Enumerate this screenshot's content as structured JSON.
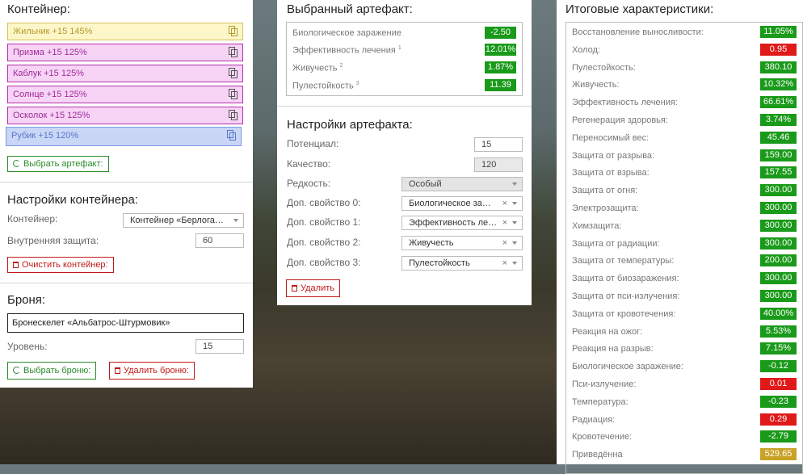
{
  "container_panel": {
    "title": "Контейнер:",
    "slots": [
      {
        "label": "Жильник +15 145%"
      },
      {
        "label": "Призма +15 125%"
      },
      {
        "label": "Каблук +15 125%"
      },
      {
        "label": "Солнце +15 125%"
      },
      {
        "label": "Осколок +15 125%"
      },
      {
        "label": "Рубик +15 120%"
      }
    ],
    "choose_artifact_button": "Выбрать артефакт:",
    "settings_title": "Настройки контейнера:",
    "container_label": "Контейнер:",
    "container_value": "Контейнер «Берлога…",
    "inner_protection_label": "Внутренняя защита:",
    "inner_protection_value": "60",
    "clear_button": "Очистить контейнер:",
    "armor_title": "Броня:",
    "armor_value": "Бронескелет «Альбатрос-Штурмовик»",
    "level_label": "Уровень:",
    "level_value": "15",
    "choose_armor_button": "Выбрать броню:",
    "delete_armor_button": "Удалить броню:"
  },
  "artifact_panel": {
    "title": "Выбранный артефакт:",
    "stats": [
      {
        "name": "Биологическое заражение",
        "sup": "",
        "value": "-2.50"
      },
      {
        "name": "Эффективность лечения",
        "sup": "1",
        "value": "12.01%"
      },
      {
        "name": "Живучесть",
        "sup": "2",
        "value": "1.87%"
      },
      {
        "name": "Пулестойкость",
        "sup": "3",
        "value": "11.39"
      }
    ],
    "settings_title": "Настройки артефакта:",
    "potential_label": "Потенциал:",
    "potential_value": "15",
    "quality_label": "Качество:",
    "quality_value": "120",
    "rarity_label": "Редкость:",
    "rarity_value": "Особый",
    "extra": [
      {
        "label": "Доп. свойство 0:",
        "value": "Биологическое за…"
      },
      {
        "label": "Доп. свойство 1:",
        "value": "Эффективность ле…"
      },
      {
        "label": "Доп. свойство 2:",
        "value": "Живучесть"
      },
      {
        "label": "Доп. свойство 3:",
        "value": "Пулестойкость"
      }
    ],
    "delete_button": "Удалить"
  },
  "totals_panel": {
    "title": "Итоговые характеристики:",
    "stats": [
      {
        "name": "Восстановление выносливости:",
        "value": "11.05%",
        "color": "green"
      },
      {
        "name": "Холод:",
        "value": "0.95",
        "color": "red"
      },
      {
        "name": "Пулестойкость:",
        "value": "380.10",
        "color": "green"
      },
      {
        "name": "Живучесть:",
        "value": "10.32%",
        "color": "green"
      },
      {
        "name": "Эффективность лечения:",
        "value": "66.61%",
        "color": "green"
      },
      {
        "name": "Регенерация здоровья:",
        "value": "3.74%",
        "color": "green"
      },
      {
        "name": "Переносимый вес:",
        "value": "45.46",
        "color": "green"
      },
      {
        "name": "Защита от разрыва:",
        "value": "159.00",
        "color": "green"
      },
      {
        "name": "Защита от взрыва:",
        "value": "157.55",
        "color": "green"
      },
      {
        "name": "Защита от огня:",
        "value": "300.00",
        "color": "green"
      },
      {
        "name": "Электрозащита:",
        "value": "300.00",
        "color": "green"
      },
      {
        "name": "Химзащита:",
        "value": "300.00",
        "color": "green"
      },
      {
        "name": "Защита от радиации:",
        "value": "300.00",
        "color": "green"
      },
      {
        "name": "Защита от температуры:",
        "value": "200.00",
        "color": "green"
      },
      {
        "name": "Защита от биозаражения:",
        "value": "300.00",
        "color": "green"
      },
      {
        "name": "Защита от пси-излучения:",
        "value": "300.00",
        "color": "green"
      },
      {
        "name": "Защита от кровотечения:",
        "value": "40.00%",
        "color": "green"
      },
      {
        "name": "Реакция на ожог:",
        "value": "5.53%",
        "color": "green"
      },
      {
        "name": "Реакция на разрыв:",
        "value": "7.15%",
        "color": "green"
      },
      {
        "name": "Биологическое заражение:",
        "value": "-0.12",
        "color": "green"
      },
      {
        "name": "Пси-излучение:",
        "value": "0.01",
        "color": "red"
      },
      {
        "name": "Температура:",
        "value": "-0.23",
        "color": "green"
      },
      {
        "name": "Радиация:",
        "value": "0.29",
        "color": "red"
      },
      {
        "name": "Кровотечение:",
        "value": "-2.79",
        "color": "green"
      },
      {
        "name": "Приведённа",
        "value": "529.65",
        "color": "yellow"
      }
    ]
  },
  "colors": {
    "slot_yellow_bg": "#fdf6c9",
    "slot_yellow_border": "#d8c05a",
    "slot_yellow_text": "#b39a2a",
    "slot_pink_bg": "#f7d4f5",
    "slot_pink_border": "#b62fb0",
    "slot_pink_text": "#a02a9a",
    "slot_blue_bg": "#c9d6f6",
    "slot_blue_border": "#7d9be0",
    "slot_blue_text": "#5a76c8",
    "green": "#1a9a1a",
    "red": "#e01919",
    "yellow": "#c9a227"
  }
}
